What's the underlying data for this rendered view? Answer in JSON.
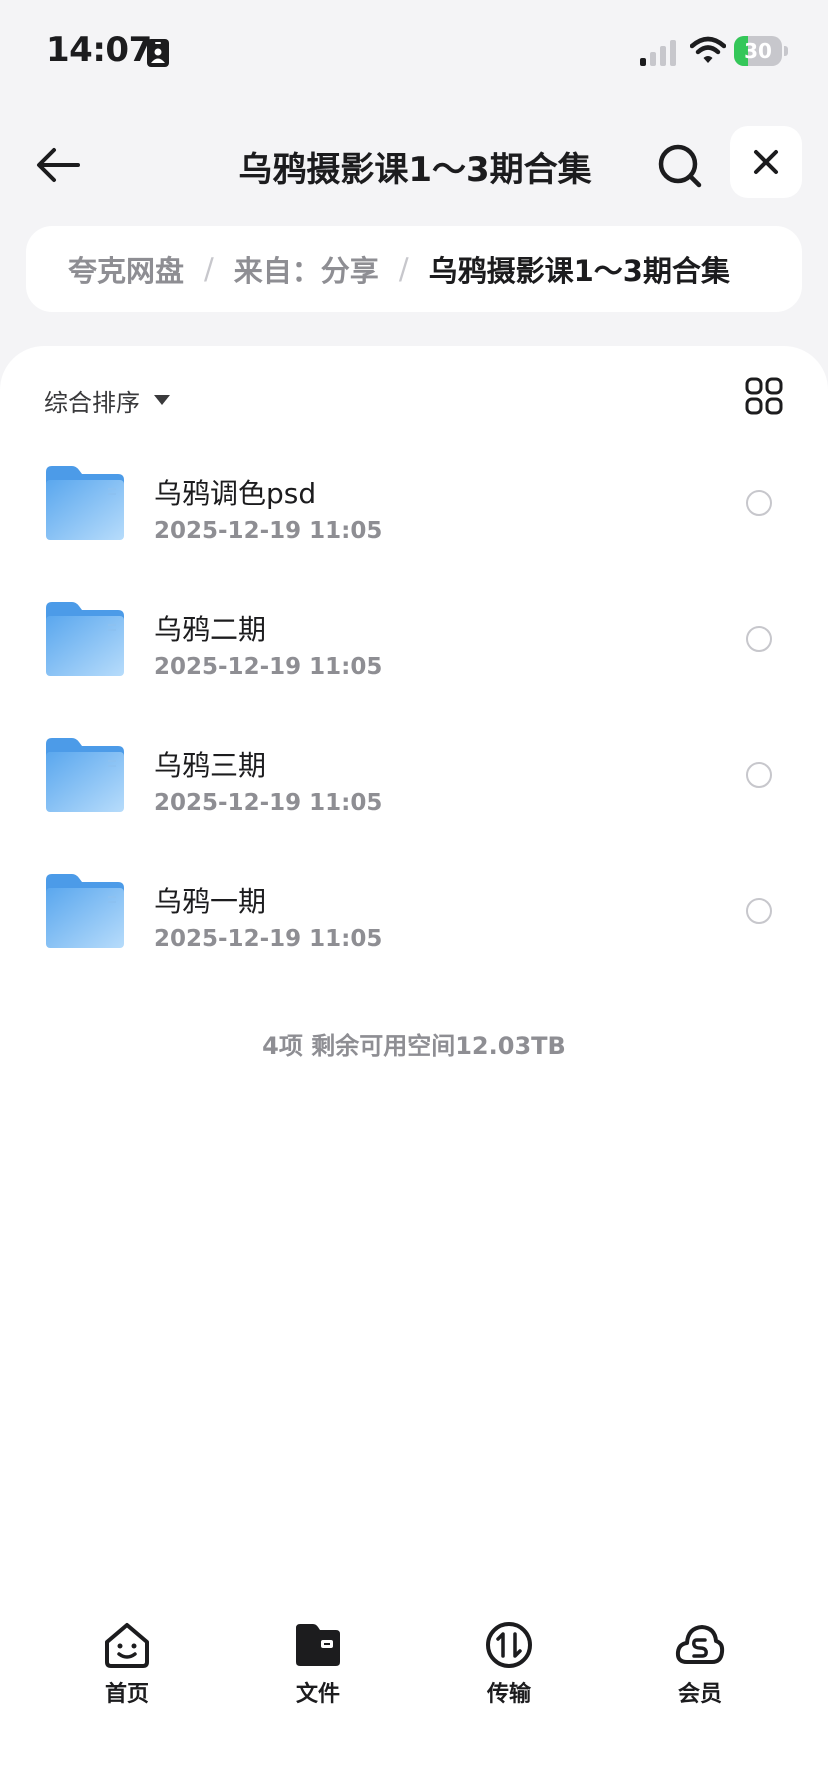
{
  "status_bar": {
    "time": "14:07",
    "battery": "30",
    "battery_level": 0.3
  },
  "header": {
    "title": "乌鸦摄影课1～3期合集"
  },
  "breadcrumb": [
    {
      "label": "夸克网盘"
    },
    {
      "label": "来自：分享"
    },
    {
      "label": "乌鸦摄影课1～3期合集"
    }
  ],
  "breadcrumb_separator": "/",
  "sort": {
    "label": "综合排序"
  },
  "files": [
    {
      "name": "乌鸦调色psd",
      "date": "2025-12-19 11:05"
    },
    {
      "name": "乌鸦二期",
      "date": "2025-12-19 11:05"
    },
    {
      "name": "乌鸦三期",
      "date": "2025-12-19 11:05"
    },
    {
      "name": "乌鸦一期",
      "date": "2025-12-19 11:05"
    }
  ],
  "summary": "4项 剩余可用空间12.03TB",
  "tabs": [
    {
      "label": "首页",
      "icon": "home-face-icon"
    },
    {
      "label": "文件",
      "icon": "folder-tab-icon"
    },
    {
      "label": "传输",
      "icon": "transfer-icon"
    },
    {
      "label": "会员",
      "icon": "member-cloud-icon"
    }
  ],
  "colors": {
    "accent_folder": "#5aa7ee",
    "battery_green": "#34c759"
  }
}
